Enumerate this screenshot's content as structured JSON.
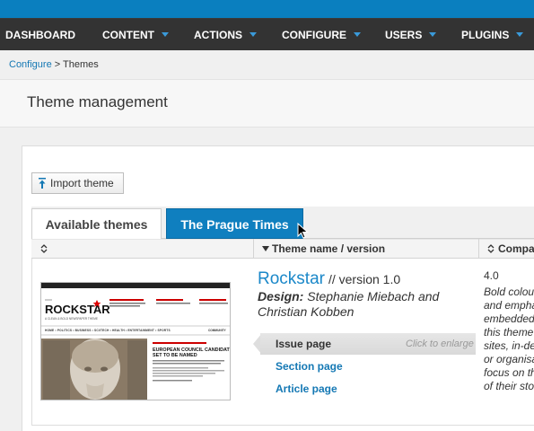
{
  "nav": {
    "items": [
      {
        "label": "DASHBOARD"
      },
      {
        "label": "CONTENT"
      },
      {
        "label": "ACTIONS"
      },
      {
        "label": "CONFIGURE"
      },
      {
        "label": "USERS"
      },
      {
        "label": "PLUGINS"
      }
    ]
  },
  "breadcrumb": {
    "parent": "Configure",
    "separator": " > ",
    "current": "Themes"
  },
  "page": {
    "title": "Theme management"
  },
  "toolbar": {
    "import_label": "Import theme"
  },
  "tabs": [
    {
      "label": "Available themes",
      "active": false
    },
    {
      "label": "The Prague Times",
      "active": true
    }
  ],
  "table": {
    "headers": [
      "",
      "Theme name / version",
      "Compatibility"
    ],
    "headers_visible": [
      "",
      "Theme name / version",
      "Compa"
    ],
    "row": {
      "name": "Rockstar",
      "version": "// version 1.0",
      "design_label": "Design:",
      "designers": "Stephanie Miebach and Christian Kobben",
      "issue_page": "Issue page",
      "click_to_enlarge": "Click to enlarge",
      "section_page": "Section page",
      "article_page": "Article page",
      "compat_version": "4.0",
      "compat_desc": "Bold colours and emphasis... embedded... this theme... sites, in-de... or organisa... focus on th... of their sto..."
    }
  },
  "thumbnail": {
    "masthead": "ROCKSTAR",
    "tagline": "A CLEAN & BOLD NEWSPAPER THEME",
    "headline": "EUROPEAN COUNCIL CANDIDATES SET TO BE NAMED",
    "nav_words": [
      "HOME",
      "POLITICS",
      "BUSINESS",
      "SCI/TECH",
      "HEALTH",
      "ENTERTAINMENT",
      "SPORTS",
      "COMMUNITY"
    ]
  },
  "colors": {
    "brand": "#0a7fbf",
    "nav_bg": "#333333",
    "link": "#1478b4",
    "title_link": "#1b88c9"
  }
}
